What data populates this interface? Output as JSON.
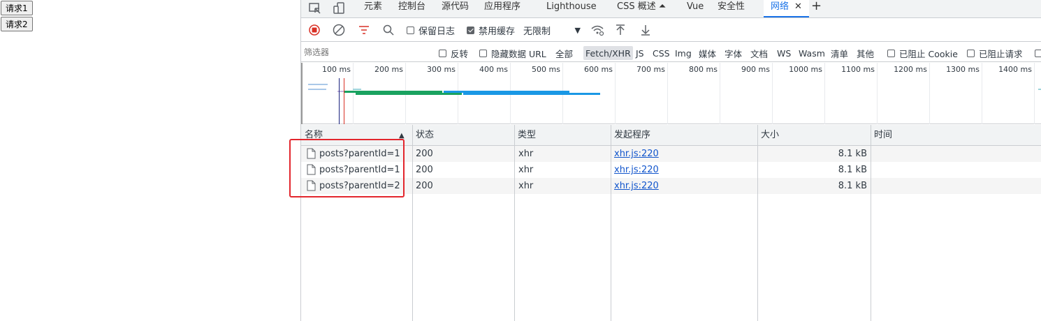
{
  "page": {
    "buttons": [
      "请求1",
      "请求2"
    ]
  },
  "devtools": {
    "tabs": [
      {
        "label": "元素"
      },
      {
        "label": "控制台"
      },
      {
        "label": "源代码"
      },
      {
        "label": "应用程序"
      },
      {
        "label": "Lighthouse"
      },
      {
        "label": "CSS 概述 ⏶"
      },
      {
        "label": "Vue"
      },
      {
        "label": "安全性"
      },
      {
        "label": "网络",
        "active": true
      }
    ],
    "toolbar": {
      "preserve_log": "保留日志",
      "disable_cache": "禁用缓存",
      "throttle": "无限制"
    },
    "filter": {
      "placeholder": "筛选器",
      "invert": "反转",
      "hide_data_urls": "隐藏数据 URL",
      "types": [
        "全部",
        "Fetch/XHR",
        "JS",
        "CSS",
        "Img",
        "媒体",
        "字体",
        "文档",
        "WS",
        "Wasm",
        "清单",
        "其他"
      ],
      "selected_type": "Fetch/XHR",
      "blocked_cookies": "已阻止 Cookie",
      "blocked_requests": "已阻止请求"
    },
    "timeline_ticks": [
      "100 ms",
      "200 ms",
      "300 ms",
      "400 ms",
      "500 ms",
      "600 ms",
      "700 ms",
      "800 ms",
      "900 ms",
      "1000 ms",
      "1100 ms",
      "1200 ms",
      "1300 ms",
      "1400 ms"
    ],
    "columns": [
      "名称",
      "状态",
      "类型",
      "发起程序",
      "大小",
      "时间"
    ],
    "rows": [
      {
        "name": "posts?parentId=1",
        "status": "200",
        "type": "xhr",
        "initiator": "xhr.js:220",
        "size": "8.1 kB",
        "time": ""
      },
      {
        "name": "posts?parentId=1",
        "status": "200",
        "type": "xhr",
        "initiator": "xhr.js:220",
        "size": "8.1 kB",
        "time": ""
      },
      {
        "name": "posts?parentId=2",
        "status": "200",
        "type": "xhr",
        "initiator": "xhr.js:220",
        "size": "8.1 kB",
        "time": ""
      }
    ]
  }
}
